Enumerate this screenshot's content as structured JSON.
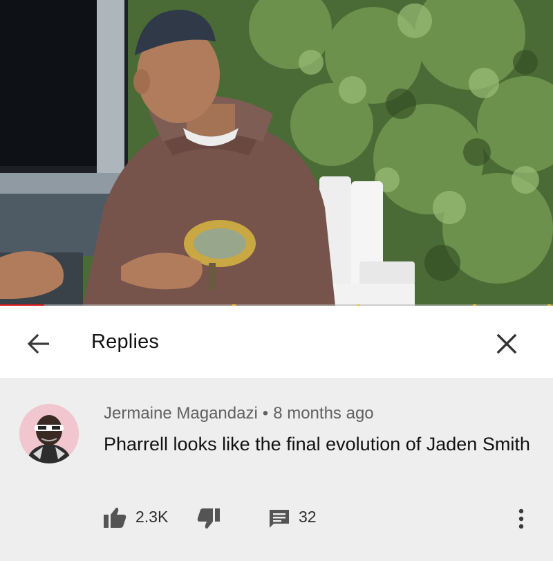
{
  "video": {
    "progress_fraction": 0.08,
    "chapter_marks": [
      0.42,
      0.645,
      0.855,
      0.99
    ]
  },
  "header": {
    "back_icon": "arrow-left-icon",
    "title": "Replies",
    "close_icon": "close-icon"
  },
  "comment": {
    "author": "Jermaine Magandazi",
    "separator": "•",
    "time": "8 months ago",
    "text": "Pharrell looks like the final evolution of Jaden Smith",
    "likes": "2.3K",
    "replies": "32",
    "icons": [
      "thumbs-up-icon",
      "thumbs-down-icon",
      "reply-icon",
      "more-vert-icon"
    ]
  },
  "colors": {
    "progress": "#e21b1b",
    "chapter": "#f1c232",
    "card_bg": "#eeeeee"
  }
}
